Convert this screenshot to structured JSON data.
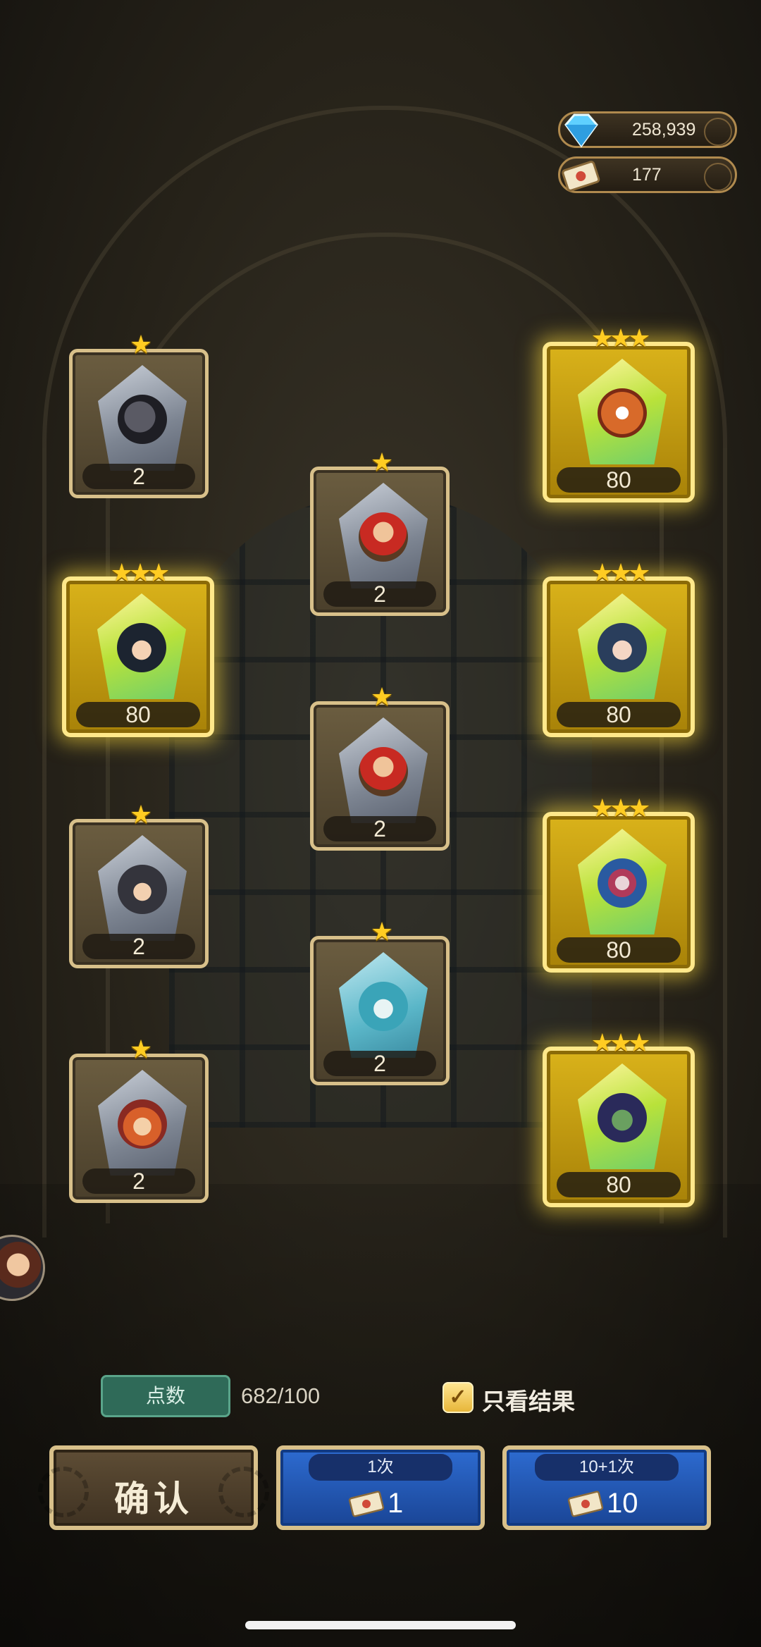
{
  "currency": {
    "gems": "258,939",
    "tickets": "177"
  },
  "heroes": [
    {
      "id": "hero-plague-doctor",
      "rarity": 1,
      "count": "2"
    },
    {
      "id": "hero-red-panda",
      "rarity": 3,
      "count": "80"
    },
    {
      "id": "hero-dwarf-a",
      "rarity": 1,
      "count": "2"
    },
    {
      "id": "hero-dark-hair",
      "rarity": 3,
      "count": "80"
    },
    {
      "id": "hero-blue-hair",
      "rarity": 3,
      "count": "80"
    },
    {
      "id": "hero-dwarf-b",
      "rarity": 1,
      "count": "2"
    },
    {
      "id": "hero-hooded",
      "rarity": 1,
      "count": "2"
    },
    {
      "id": "hero-masked",
      "rarity": 3,
      "count": "80"
    },
    {
      "id": "hero-ice-spirit",
      "rarity": 1,
      "count": "2"
    },
    {
      "id": "hero-goggles",
      "rarity": 1,
      "count": "2"
    },
    {
      "id": "hero-frog-knight",
      "rarity": 3,
      "count": "80"
    }
  ],
  "points": {
    "label": "点数",
    "value": "682/100"
  },
  "results_only": {
    "label": "只看结果",
    "checked": true
  },
  "buttons": {
    "confirm": "确认",
    "single": {
      "label": "1次",
      "cost": "1"
    },
    "multi": {
      "label": "10+1次",
      "cost": "10"
    }
  },
  "colors": {
    "gold": "#d8c08a",
    "legendary": "#ffe88a",
    "blue_button": "#2d6bd0",
    "points_green": "#2f6a58"
  }
}
